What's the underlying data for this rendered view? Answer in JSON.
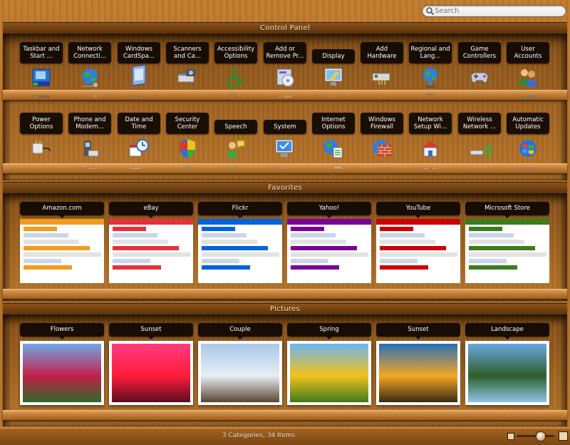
{
  "search": {
    "placeholder": "Search"
  },
  "sections": {
    "control_panel": "Control Panel",
    "favorites": "Favorites",
    "pictures": "Pictures"
  },
  "control_row1": [
    {
      "label": "Taskbar and\nStart ...",
      "icon": "taskbar-icon"
    },
    {
      "label": "Network\nConnecti...",
      "icon": "globe-network-icon"
    },
    {
      "label": "Windows\nCardSpa...",
      "icon": "cardspace-icon"
    },
    {
      "label": "Scanners\nand Ca...",
      "icon": "scanner-camera-icon"
    },
    {
      "label": "Accessibility\nOptions",
      "icon": "accessibility-icon"
    },
    {
      "label": "Add or\nRemove Pr...",
      "icon": "add-remove-programs-icon"
    },
    {
      "label": "Display",
      "icon": "display-icon"
    },
    {
      "label": "Add\nHardware",
      "icon": "add-hardware-icon"
    },
    {
      "label": "Regional and\nLang...",
      "icon": "regional-globe-icon"
    },
    {
      "label": "Game\nControllers",
      "icon": "gamepad-icon"
    },
    {
      "label": "User\nAccounts",
      "icon": "user-accounts-icon"
    }
  ],
  "control_row2": [
    {
      "label": "Power\nOptions",
      "icon": "power-icon"
    },
    {
      "label": "Phone and\nModem...",
      "icon": "phone-modem-icon"
    },
    {
      "label": "Date and\nTime",
      "icon": "date-time-icon"
    },
    {
      "label": "Security\nCenter",
      "icon": "security-shield-icon"
    },
    {
      "label": "Speech",
      "icon": "speech-icon"
    },
    {
      "label": "System",
      "icon": "system-computer-icon"
    },
    {
      "label": "Internet\nOptions",
      "icon": "internet-options-icon"
    },
    {
      "label": "Windows\nFirewall",
      "icon": "firewall-icon"
    },
    {
      "label": "Network\nSetup Wi...",
      "icon": "network-setup-house-icon"
    },
    {
      "label": "Wireless\nNetwork ...",
      "icon": "wireless-icon"
    },
    {
      "label": "Automatic\nUpdates",
      "icon": "windows-update-icon"
    }
  ],
  "favorites": [
    {
      "label": "Amazon.com",
      "accent": "#f29c1f"
    },
    {
      "label": "eBay",
      "accent": "#e53238"
    },
    {
      "label": "Flickr",
      "accent": "#0063dc"
    },
    {
      "label": "Yahoo!",
      "accent": "#7b0099"
    },
    {
      "label": "YouTube",
      "accent": "#cc0000"
    },
    {
      "label": "Microsoft Store",
      "accent": "#3a7d1a"
    }
  ],
  "pictures": [
    {
      "label": "Flowers",
      "colors": [
        "#6fa8e6",
        "#c2204a",
        "#2d6a2a"
      ]
    },
    {
      "label": "Sunset",
      "colors": [
        "#ff3d7f",
        "#ff1b3a",
        "#5a0d1f"
      ]
    },
    {
      "label": "Couple",
      "colors": [
        "#a9c8e8",
        "#e8eef4",
        "#5c4630"
      ]
    },
    {
      "label": "Spring",
      "colors": [
        "#6cb7f0",
        "#f2c21b",
        "#3f7a1c"
      ]
    },
    {
      "label": "Sunset",
      "colors": [
        "#2a6fb8",
        "#f5a623",
        "#3a2a10"
      ]
    },
    {
      "label": "Landscape",
      "colors": [
        "#6aa6e0",
        "#2d5e2a",
        "#8fc3e6"
      ]
    }
  ],
  "status": {
    "text": "3 Categories, 34 Items"
  }
}
